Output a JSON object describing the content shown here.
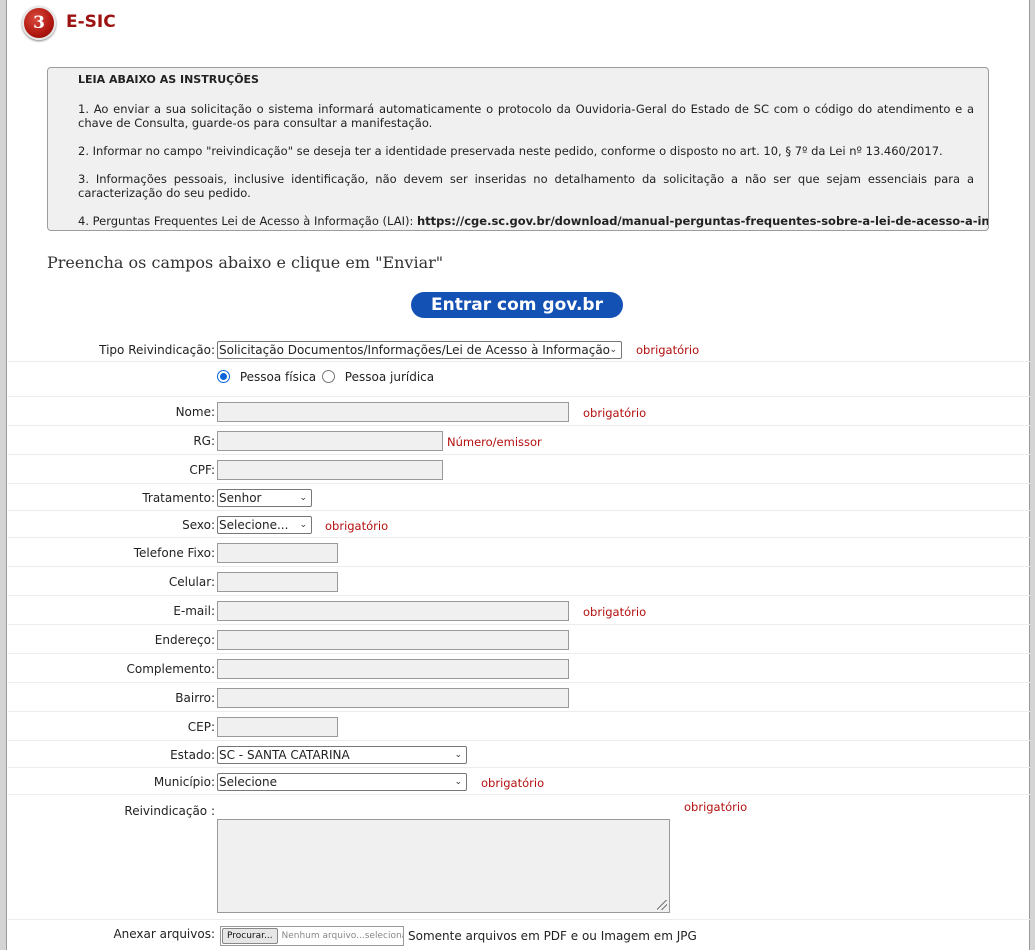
{
  "section": {
    "step_number": "3",
    "title": "E-SIC"
  },
  "instructions": {
    "title": "LEIA ABAIXO AS INSTRUÇÕES",
    "items": [
      "1. Ao enviar a sua solicitação o sistema informará automaticamente o protocolo da Ouvidoria-Geral do Estado de SC com o código do atendimento e a chave de Consulta, guarde-os para consultar a manifestação.",
      "2. Informar no campo \"reivindicação\" se deseja ter a identidade preservada neste pedido, conforme o disposto no art. 10, § 7º da Lei nº 13.460/2017.",
      "3. Informações pessoais, inclusive identificação, não devem ser inseridas no detalhamento da solicitação a não ser que sejam essenciais para a caracterização do seu pedido."
    ],
    "faq_prefix": "4. Perguntas Frequentes Lei de Acesso à Informação (LAI): ",
    "faq_link": "https://cge.sc.gov.br/download/manual-perguntas-frequentes-sobre-a-lei-de-acesso-a-informacao-lai/"
  },
  "form_heading": "Preencha os campos abaixo e clique em \"Enviar\"",
  "govbr_button": "Entrar com gov.br",
  "required_text": "obrigatório",
  "form": {
    "tipo": {
      "label": "Tipo Reivindicação:",
      "value": "Solicitação Documentos/Informações/Lei de Acesso à Informação"
    },
    "pessoa": {
      "fisica": "Pessoa física",
      "juridica": "Pessoa jurídica",
      "selected": "fisica"
    },
    "nome": {
      "label": "Nome:",
      "value": ""
    },
    "rg": {
      "label": "RG:",
      "value": "",
      "hint": "Número/emissor"
    },
    "cpf": {
      "label": "CPF:",
      "value": ""
    },
    "tratamento": {
      "label": "Tratamento:",
      "value": "Senhor"
    },
    "sexo": {
      "label": "Sexo:",
      "value": "Selecione..."
    },
    "telefone": {
      "label": "Telefone Fixo:",
      "value": ""
    },
    "celular": {
      "label": "Celular:",
      "value": ""
    },
    "email": {
      "label": "E-mail:",
      "value": ""
    },
    "endereco": {
      "label": "Endereço:",
      "value": ""
    },
    "complemento": {
      "label": "Complemento:",
      "value": ""
    },
    "bairro": {
      "label": "Bairro:",
      "value": ""
    },
    "cep": {
      "label": "CEP:",
      "value": ""
    },
    "estado": {
      "label": "Estado:",
      "value": "SC - SANTA CATARINA"
    },
    "municipio": {
      "label": "Município:",
      "value": "Selecione"
    },
    "reivindicacao": {
      "label": "Reivindicação :",
      "value": ""
    },
    "anexar": {
      "label": "Anexar arquivos:",
      "browse_label": "Procurar...",
      "file_status": "Nenhum arquivo...selecionado.",
      "note": "Somente arquivos em PDF e ou Imagem em JPG"
    }
  }
}
